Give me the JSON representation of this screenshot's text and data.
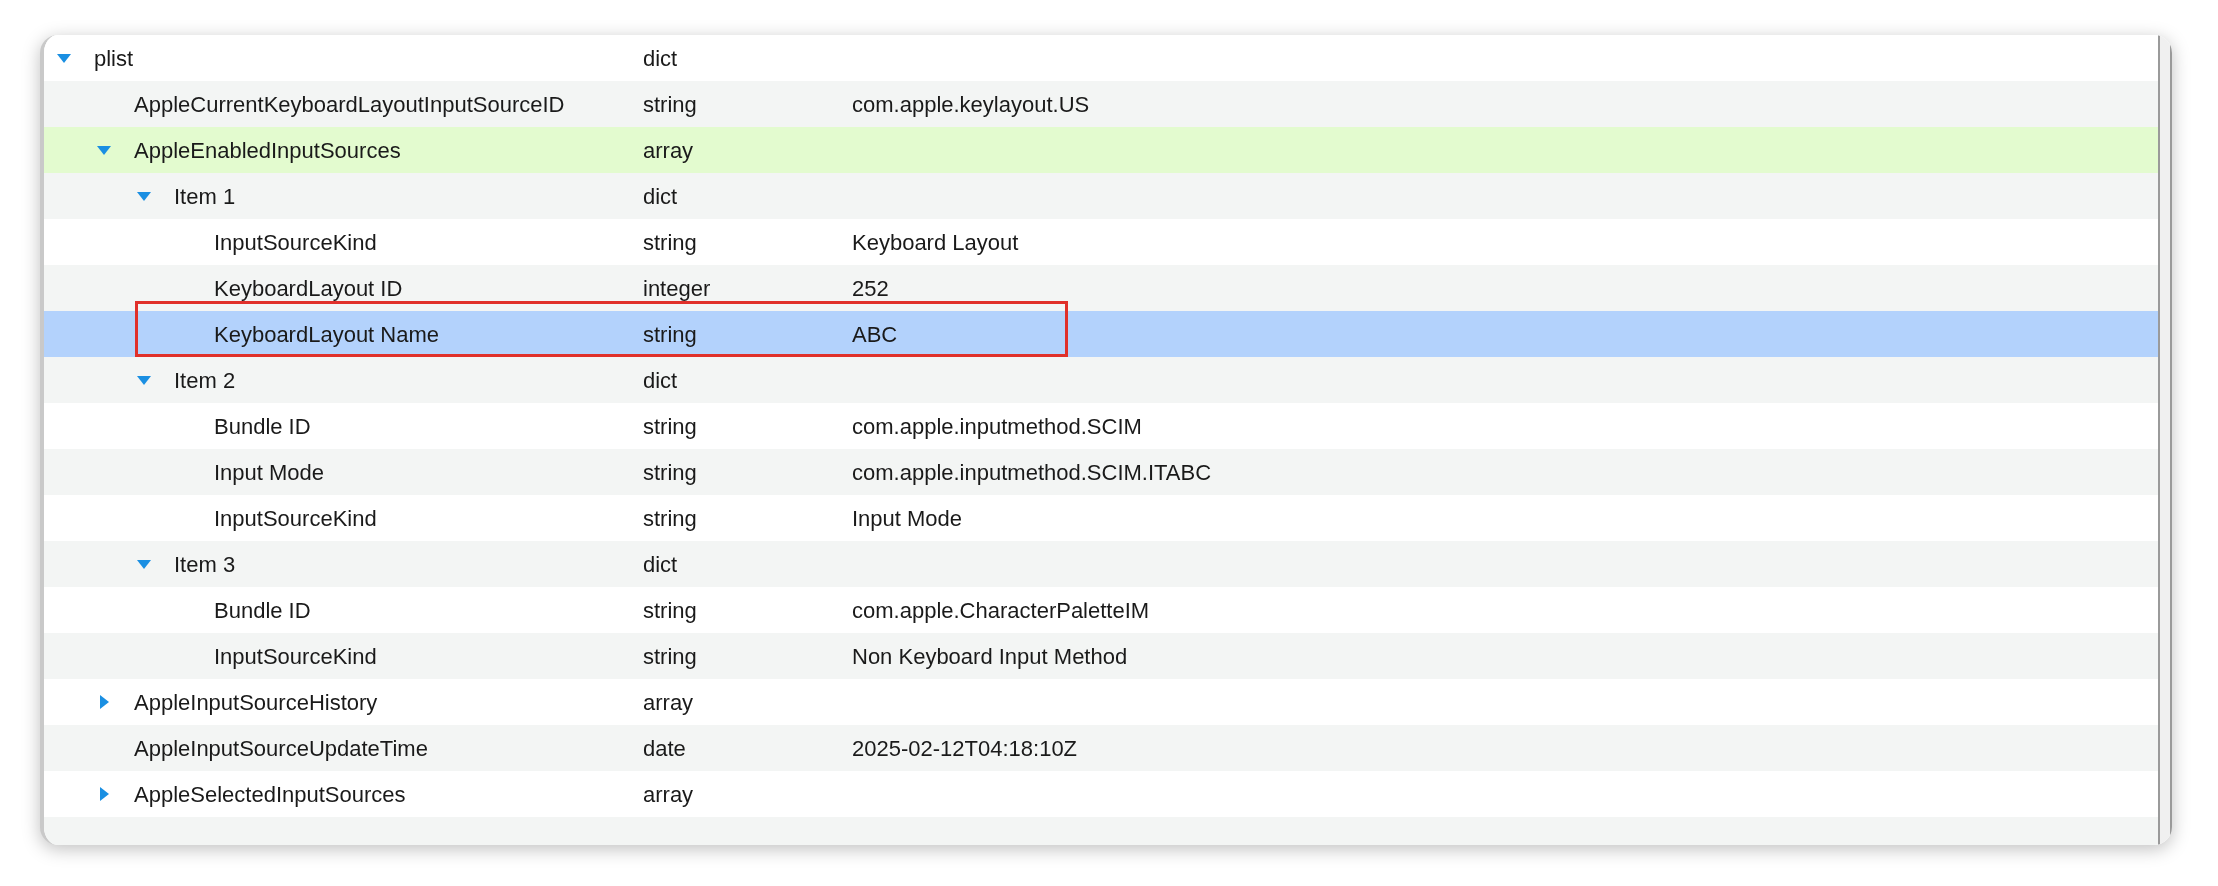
{
  "tree": [
    {
      "key": "plist",
      "type": "dict",
      "expanded": true,
      "selected": false,
      "highlighted": false,
      "children": [
        {
          "key": "AppleCurrentKeyboardLayoutInputSourceID",
          "type": "string",
          "value": "com.apple.keylayout.US",
          "selected": false,
          "highlighted": false
        },
        {
          "key": "AppleEnabledInputSources",
          "type": "array",
          "expanded": true,
          "selected": false,
          "highlighted": true,
          "children": [
            {
              "key": "Item 1",
              "type": "dict",
              "expanded": true,
              "selected": false,
              "highlighted": false,
              "children": [
                {
                  "key": "InputSourceKind",
                  "type": "string",
                  "value": "Keyboard Layout",
                  "selected": false,
                  "highlighted": false
                },
                {
                  "key": "KeyboardLayout ID",
                  "type": "integer",
                  "value": "252",
                  "selected": false,
                  "highlighted": false
                },
                {
                  "key": "KeyboardLayout Name",
                  "type": "string",
                  "value": "ABC",
                  "selected": true,
                  "boxed": true
                }
              ]
            },
            {
              "key": "Item 2",
              "type": "dict",
              "expanded": true,
              "selected": false,
              "highlighted": false,
              "children": [
                {
                  "key": "Bundle ID",
                  "type": "string",
                  "value": "com.apple.inputmethod.SCIM",
                  "selected": false,
                  "highlighted": false
                },
                {
                  "key": "Input Mode",
                  "type": "string",
                  "value": "com.apple.inputmethod.SCIM.ITABC",
                  "selected": false,
                  "highlighted": false
                },
                {
                  "key": "InputSourceKind",
                  "type": "string",
                  "value": "Input Mode",
                  "selected": false,
                  "highlighted": false
                }
              ]
            },
            {
              "key": "Item 3",
              "type": "dict",
              "expanded": true,
              "selected": false,
              "highlighted": false,
              "children": [
                {
                  "key": "Bundle ID",
                  "type": "string",
                  "value": "com.apple.CharacterPaletteIM",
                  "selected": false,
                  "highlighted": false
                },
                {
                  "key": "InputSourceKind",
                  "type": "string",
                  "value": "Non Keyboard Input Method",
                  "selected": false,
                  "highlighted": false
                }
              ]
            }
          ]
        },
        {
          "key": "AppleInputSourceHistory",
          "type": "array",
          "expanded": false,
          "selected": false,
          "highlighted": false
        },
        {
          "key": "AppleInputSourceUpdateTime",
          "type": "date",
          "value": "2025-02-12T04:18:10Z",
          "selected": false,
          "highlighted": false
        },
        {
          "key": "AppleSelectedInputSources",
          "type": "array",
          "expanded": false,
          "selected": false,
          "highlighted": false
        }
      ]
    }
  ]
}
